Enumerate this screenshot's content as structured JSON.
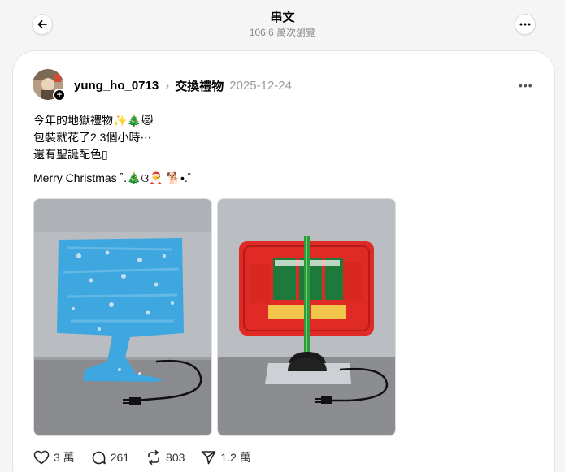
{
  "header": {
    "title": "串文",
    "subtitle": "106.6 萬次瀏覽"
  },
  "post": {
    "username": "yung_ho_0713",
    "topic": "交換禮物",
    "date": "2025-12-24",
    "lines": [
      "今年的地獄禮物✨🎄😻",
      "包裝就花了2.3個小時⋯",
      "還有聖誕配色▯",
      "Merry Christmas ˚.🎄ଓ🎅 🐕•.˚"
    ],
    "actions": {
      "likes": "3 萬",
      "replies": "261",
      "reposts": "803",
      "shares": "1.2 萬"
    },
    "images": [
      {
        "name": "blue-wrapped-gift",
        "colors": {
          "wrap": "#3fa7df",
          "wall": "#b9bcc0",
          "table": "#8a8b8f"
        }
      },
      {
        "name": "red-tray-pocky-lamp",
        "colors": {
          "tray": "#e02a26",
          "stick": "#2e9b3c",
          "box": "#1e7a3b"
        }
      }
    ]
  }
}
